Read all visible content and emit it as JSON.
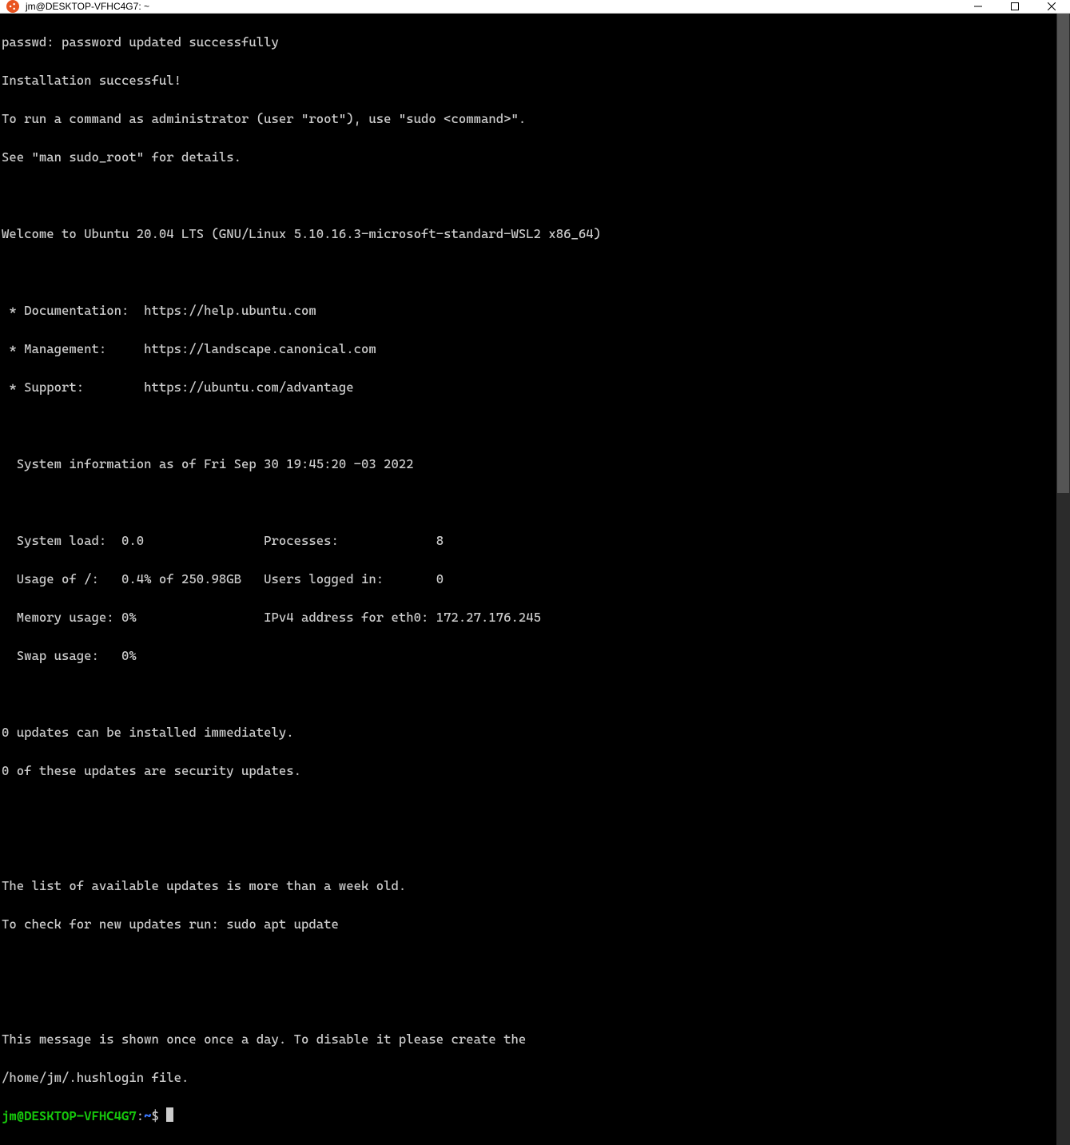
{
  "window": {
    "title": "jm@DESKTOP-VFHC4G7: ~"
  },
  "lines": {
    "l0": "passwd: password updated successfully",
    "l1": "Installation successful!",
    "l2": "To run a command as administrator (user \"root\"), use \"sudo <command>\".",
    "l3": "See \"man sudo_root\" for details.",
    "l4": "",
    "l5": "Welcome to Ubuntu 20.04 LTS (GNU/Linux 5.10.16.3-microsoft-standard-WSL2 x86_64)",
    "l6": "",
    "l7": " * Documentation:  https://help.ubuntu.com",
    "l8": " * Management:     https://landscape.canonical.com",
    "l9": " * Support:        https://ubuntu.com/advantage",
    "l10": "",
    "l11": "  System information as of Fri Sep 30 19:45:20 -03 2022",
    "l12": "",
    "l13": "  System load:  0.0                Processes:             8",
    "l14": "  Usage of /:   0.4% of 250.98GB   Users logged in:       0",
    "l15": "  Memory usage: 0%                 IPv4 address for eth0: 172.27.176.245",
    "l16": "  Swap usage:   0%",
    "l17": "",
    "l18": "0 updates can be installed immediately.",
    "l19": "0 of these updates are security updates.",
    "l20": "",
    "l21": "",
    "l22": "The list of available updates is more than a week old.",
    "l23": "To check for new updates run: sudo apt update",
    "l24": "",
    "l25": "",
    "l26": "This message is shown once once a day. To disable it please create the",
    "l27": "/home/jm/.hushlogin file."
  },
  "prompt": {
    "userhost": "jm@DESKTOP-VFHC4G7",
    "colon": ":",
    "path": "~",
    "dollar": "$"
  }
}
